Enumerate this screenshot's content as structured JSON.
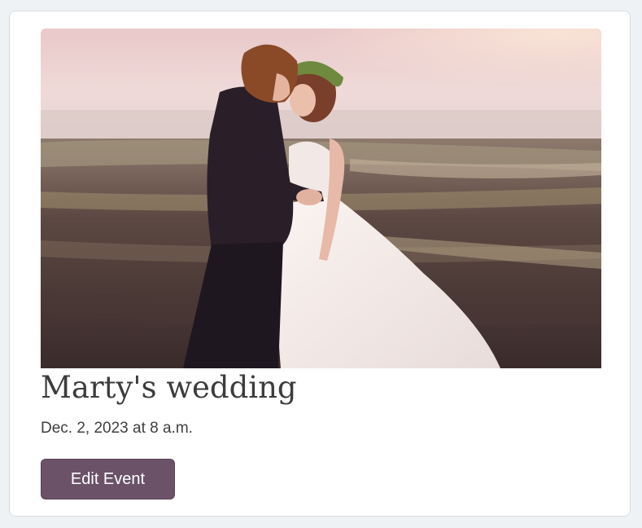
{
  "event": {
    "title": "Marty's wedding",
    "date": "Dec. 2, 2023 at 8 a.m.",
    "photo_alt": "couple embracing in a field at sunset",
    "edit_label": "Edit Event"
  },
  "colors": {
    "page_background": "#eef2f4",
    "button": "#6b5268",
    "title_text": "#3c3c3c"
  }
}
